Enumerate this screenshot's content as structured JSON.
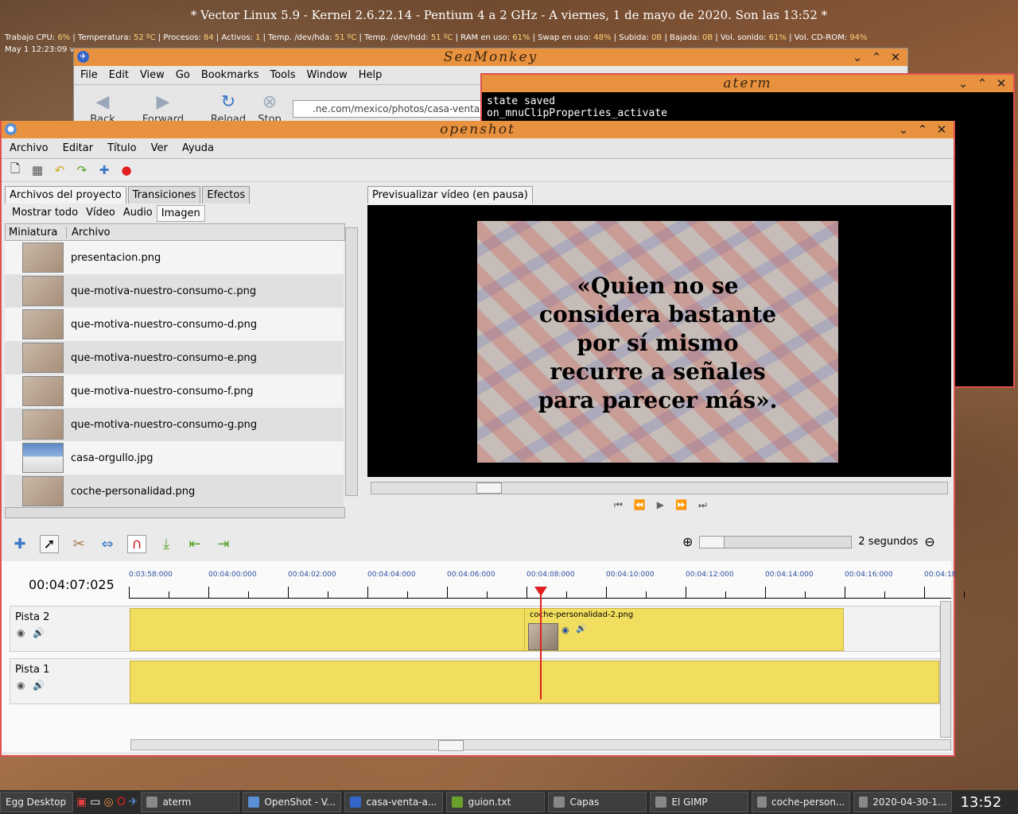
{
  "desktop": {
    "title_bar": "*  Vector Linux 5.9 - Kernel 2.6.22.14 - Pentium 4 a 2 GHz      -      A viernes,  1 de mayo de 2020. Son las 13:52  *",
    "status": [
      {
        "label": "Trabajo CPU:",
        "value": "6%"
      },
      {
        "label": "Temperatura:",
        "value": "52 ºC"
      },
      {
        "label": "Procesos:",
        "value": "84"
      },
      {
        "label": "Activos:",
        "value": "1"
      },
      {
        "label": "Temp. /dev/hda:",
        "value": "51 ºC"
      },
      {
        "label": "Temp. /dev/hdd:",
        "value": "51 ºC"
      },
      {
        "label": "RAM en uso:",
        "value": "61%"
      },
      {
        "label": "Swap en uso:",
        "value": "48%"
      },
      {
        "label": "Subida:",
        "value": "0B"
      },
      {
        "label": "Bajada:",
        "value": "0B"
      },
      {
        "label": "Vol. sonido:",
        "value": "61%"
      },
      {
        "label": "Vol. CD-ROM:",
        "value": "94%"
      }
    ],
    "log_line": "May  1 12:23:09 v"
  },
  "seamonkey": {
    "title": "SeaMonkey",
    "menu": [
      "File",
      "Edit",
      "View",
      "Go",
      "Bookmarks",
      "Tools",
      "Window",
      "Help"
    ],
    "nav": {
      "back": "Back",
      "forward": "Forward",
      "reload": "Reload",
      "stop": "Stop"
    },
    "url": ".ne.com/mexico/photos/casa-venta"
  },
  "aterm": {
    "title": "aterm",
    "lines": [
      "state saved",
      "on_mnuClipProperties_activate"
    ]
  },
  "openshot": {
    "title": "openshot",
    "menu": [
      "Archivo",
      "Editar",
      "Título",
      "Ver",
      "Ayuda"
    ],
    "tabs": [
      "Archivos del proyecto",
      "Transiciones",
      "Efectos"
    ],
    "filters": [
      "Mostrar todo",
      "Vídeo",
      "Audio",
      "Imagen"
    ],
    "columns": {
      "thumb": "Miniatura",
      "file": "Archivo"
    },
    "files": [
      "presentacion.png",
      "que-motiva-nuestro-consumo-c.png",
      "que-motiva-nuestro-consumo-d.png",
      "que-motiva-nuestro-consumo-e.png",
      "que-motiva-nuestro-consumo-f.png",
      "que-motiva-nuestro-consumo-g.png",
      "casa-orgullo.jpg",
      "coche-personalidad.png"
    ],
    "preview_tab": "Previsualizar vídeo (en pausa)",
    "quote": [
      "«Quien no se",
      "considera bastante",
      "por sí mismo",
      "recurre a señales",
      "para parecer más»."
    ],
    "timecode": "00:04:07:025",
    "zoom_label": "2 segundos",
    "ruler": [
      "0:03:58:000",
      "00:04:00:000",
      "00:04:02:000",
      "00:04:04:000",
      "00:04:06:000",
      "00:04:08:000",
      "00:04:10:000",
      "00:04:12:000",
      "00:04:14:000",
      "00:04:16:000",
      "00:04:18"
    ],
    "tracks": [
      {
        "name": "Pista 2"
      },
      {
        "name": "Pista 1"
      }
    ],
    "clip_label": "coche-personalidad-2.png"
  },
  "taskbar": {
    "start": "Egg Desktop",
    "items": [
      "aterm",
      "OpenShot - V...",
      "casa-venta-a...",
      "guion.txt",
      "Capas",
      "El GIMP",
      "coche-person...",
      "2020-04-30-1..."
    ],
    "clock": "13:52"
  }
}
